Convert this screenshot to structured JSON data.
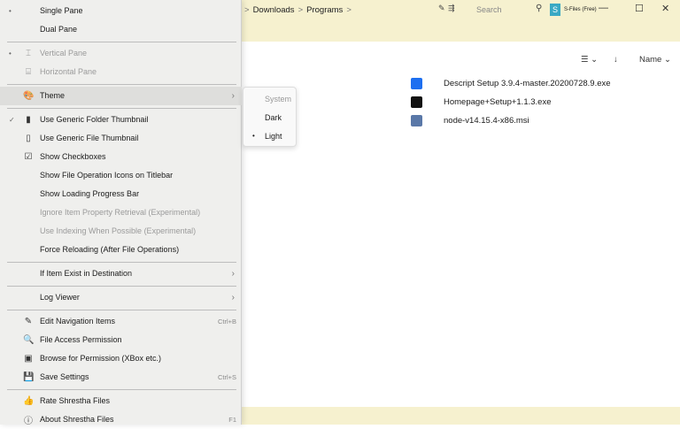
{
  "breadcrumb": [
    "Downloads",
    "Programs"
  ],
  "search_placeholder": "Search",
  "app_name": "S-Files (Free)",
  "sort_label": "Name",
  "files": [
    {
      "name": "Descript Setup 3.9.4-master.20200728.9.exe",
      "color": "#1e6ff0"
    },
    {
      "name": "Homepage+Setup+1.1.3.exe",
      "color": "#111111"
    },
    {
      "name": "node-v14.15.4-x86.msi",
      "color": "#5a78a8"
    }
  ],
  "menu": [
    {
      "type": "item",
      "label": "Single Pane",
      "mark": "•"
    },
    {
      "type": "item",
      "label": "Dual Pane"
    },
    {
      "type": "sep"
    },
    {
      "type": "item",
      "label": "Vertical Pane",
      "mark": "•",
      "icon": "⌶",
      "disabled": true
    },
    {
      "type": "item",
      "label": "Horizontal Pane",
      "icon": "⌸",
      "disabled": true
    },
    {
      "type": "sep"
    },
    {
      "type": "item",
      "label": "Theme",
      "icon": "🎨",
      "submenu": true,
      "highlight": true
    },
    {
      "type": "sep"
    },
    {
      "type": "item",
      "label": "Use Generic Folder Thumbnail",
      "mark": "✓",
      "icon": "▮"
    },
    {
      "type": "item",
      "label": "Use Generic File Thumbnail",
      "icon": "▯"
    },
    {
      "type": "item",
      "label": "Show Checkboxes",
      "icon": "☑"
    },
    {
      "type": "item",
      "label": "Show File Operation Icons on Titlebar"
    },
    {
      "type": "item",
      "label": "Show Loading Progress Bar"
    },
    {
      "type": "item",
      "label": "Ignore Item Property Retrieval (Experimental)",
      "disabled": true
    },
    {
      "type": "item",
      "label": "Use Indexing When Possible (Experimental)",
      "disabled": true
    },
    {
      "type": "item",
      "label": "Force Reloading (After File Operations)"
    },
    {
      "type": "sep"
    },
    {
      "type": "item",
      "label": "If Item Exist in Destination",
      "submenu": true
    },
    {
      "type": "sep"
    },
    {
      "type": "item",
      "label": "Log Viewer",
      "submenu": true
    },
    {
      "type": "sep"
    },
    {
      "type": "item",
      "label": "Edit Navigation Items",
      "icon": "✎",
      "shortcut": "Ctrl+B"
    },
    {
      "type": "item",
      "label": "File Access Permission",
      "icon": "🔍"
    },
    {
      "type": "item",
      "label": "Browse for Permission (XBox etc.)",
      "icon": "▣"
    },
    {
      "type": "item",
      "label": "Save Settings",
      "icon": "💾",
      "shortcut": "Ctrl+S"
    },
    {
      "type": "sep"
    },
    {
      "type": "item",
      "label": "Rate Shrestha Files",
      "icon": "👍"
    },
    {
      "type": "item",
      "label": "About Shrestha Files",
      "icon": "ⓘ",
      "shortcut": "F1"
    }
  ],
  "theme_submenu": [
    {
      "label": "System",
      "disabled": true
    },
    {
      "label": "Dark"
    },
    {
      "label": "Light",
      "selected": true
    }
  ]
}
